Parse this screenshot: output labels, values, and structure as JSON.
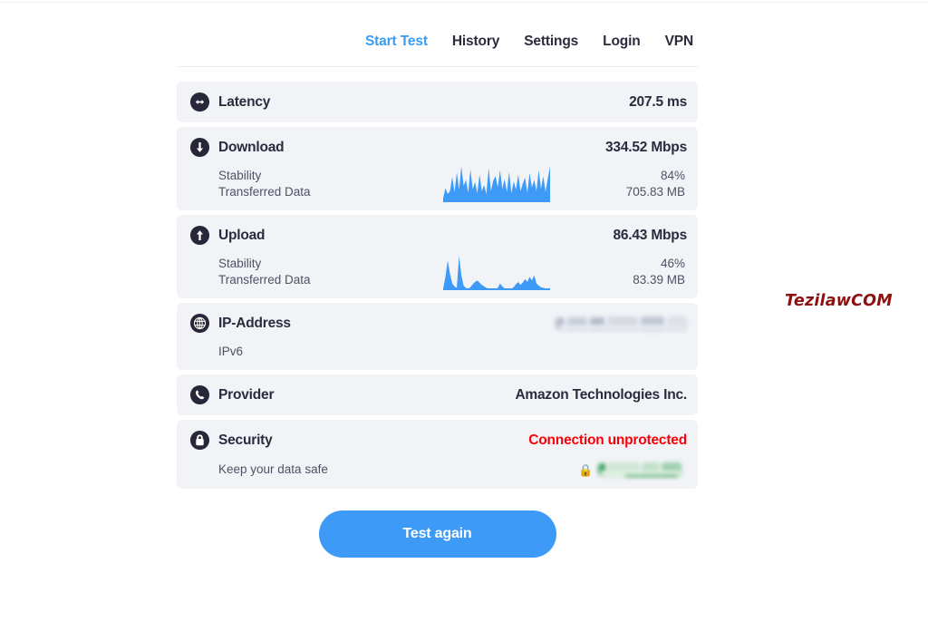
{
  "nav": {
    "items": [
      {
        "label": "Start Test",
        "active": true
      },
      {
        "label": "History",
        "active": false
      },
      {
        "label": "Settings",
        "active": false
      },
      {
        "label": "Login",
        "active": false
      },
      {
        "label": "VPN",
        "active": false
      }
    ]
  },
  "results": {
    "latency": {
      "icon": "arrows-horizontal-icon",
      "label": "Latency",
      "value": "207.5 ms"
    },
    "download": {
      "icon": "arrow-down-circle-icon",
      "label": "Download",
      "value": "334.52 Mbps",
      "stability_label": "Stability",
      "stability_value": "84%",
      "transferred_label": "Transferred Data",
      "transferred_value": "705.83 MB"
    },
    "upload": {
      "icon": "arrow-up-circle-icon",
      "label": "Upload",
      "value": "86.43 Mbps",
      "stability_label": "Stability",
      "stability_value": "46%",
      "transferred_label": "Transferred Data",
      "transferred_value": "83.39 MB"
    },
    "ip_address": {
      "icon": "globe-icon",
      "label": "IP-Address",
      "value": "",
      "value_redacted": true,
      "sub_label": "IPv6"
    },
    "provider": {
      "icon": "phone-icon",
      "label": "Provider",
      "value": "Amazon Technologies Inc."
    },
    "security": {
      "icon": "lock-icon",
      "label": "Security",
      "value": "Connection unprotected",
      "value_color": "#fc0009",
      "sub_label": "Keep your data safe",
      "link_icon": "padlock-emoji",
      "link_text": "",
      "link_redacted": true
    }
  },
  "cta": {
    "label": "Test again",
    "color": "#3d9bf7"
  },
  "watermark": {
    "text": "TezilawCOM",
    "color": "#8d1111"
  },
  "chart_data": [
    {
      "type": "area",
      "name": "download-stability-sparkline",
      "color": "#3d9bf7",
      "values": [
        10,
        38,
        22,
        30,
        68,
        28,
        80,
        34,
        96,
        44,
        60,
        26,
        88,
        34,
        54,
        24,
        74,
        30,
        46,
        22,
        92,
        30,
        58,
        70,
        40,
        86,
        36,
        62,
        28,
        82,
        24,
        56,
        34,
        74,
        30,
        50,
        66,
        26,
        78,
        40,
        60,
        30,
        86,
        36,
        70,
        28,
        64,
        96
      ],
      "ylim": [
        0,
        100
      ],
      "grid": false
    },
    {
      "type": "area",
      "name": "upload-stability-sparkline",
      "color": "#3d9bf7",
      "values": [
        4,
        36,
        80,
        44,
        18,
        10,
        6,
        92,
        40,
        12,
        6,
        4,
        8,
        16,
        22,
        26,
        20,
        14,
        10,
        6,
        4,
        3,
        3,
        4,
        6,
        18,
        10,
        5,
        3,
        3,
        4,
        8,
        16,
        22,
        14,
        20,
        30,
        22,
        36,
        26,
        40,
        18,
        12,
        8,
        6,
        5,
        4,
        4
      ],
      "ylim": [
        0,
        100
      ],
      "grid": false
    }
  ]
}
